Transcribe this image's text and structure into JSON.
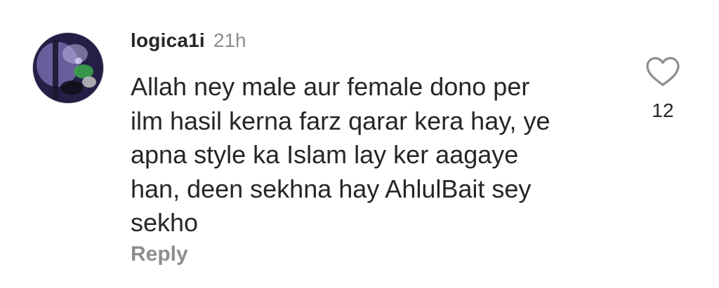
{
  "comment": {
    "username": "logica1i",
    "timestamp": "21h",
    "text_lines": [
      "Allah ney male aur female dono per",
      "ilm hasil kerna farz qarar kera hay, ye",
      "apna style ka Islam lay ker aagaye",
      "han, deen sekhna hay AhlulBait sey",
      "sekho"
    ],
    "reply_label": "Reply",
    "like_count": "12",
    "like_icon": "heart-outline-icon",
    "avatar_icon": "user-avatar-photo"
  },
  "colors": {
    "primary_text": "#262626",
    "secondary_text": "#8e8e8e",
    "background": "#ffffff"
  }
}
